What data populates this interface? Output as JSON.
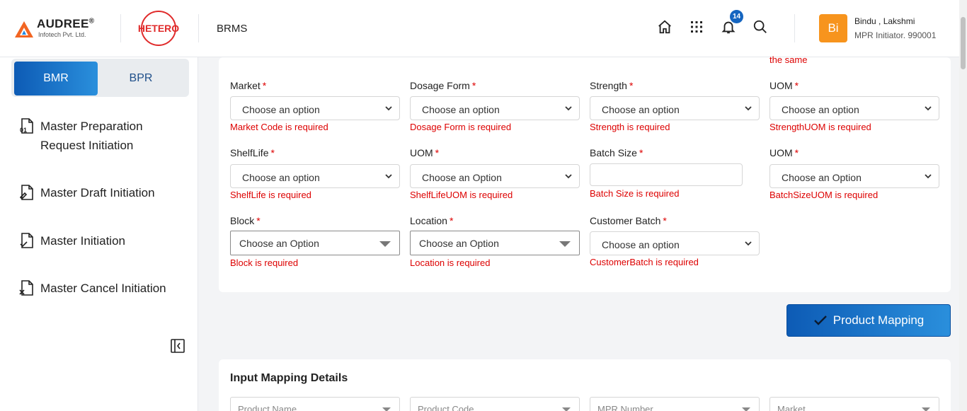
{
  "header": {
    "brand_name": "AUDREE",
    "brand_reg": "®",
    "brand_sub": "Infotech Pvt. Ltd.",
    "partner_logo": "HETERO",
    "app_name": "BRMS",
    "notification_count": "14",
    "user": {
      "initials": "Bi",
      "name": "Bindu , Lakshmi",
      "role": "MPR Initiator. 990001"
    }
  },
  "sidebar": {
    "tabs": [
      {
        "label": "BMR",
        "active": true
      },
      {
        "label": "BPR",
        "active": false
      }
    ],
    "items": [
      {
        "label": "Master Preparation Request Initiation",
        "icon": "document-number-icon"
      },
      {
        "label": "Master Draft Initiation",
        "icon": "document-edit-icon"
      },
      {
        "label": "Master Initiation",
        "icon": "document-check-icon"
      },
      {
        "label": "Master Cancel Initiation",
        "icon": "document-cancel-icon"
      }
    ]
  },
  "form": {
    "top_error": "the same",
    "fields": {
      "market": {
        "label": "Market",
        "value": "Choose an option",
        "error": "Market Code is required"
      },
      "dosage_form": {
        "label": "Dosage Form",
        "value": "Choose an option",
        "error": "Dosage Form is required"
      },
      "strength": {
        "label": "Strength",
        "value": "Choose an option",
        "error": "Strength is required"
      },
      "strength_uom": {
        "label": "UOM",
        "value": "Choose an option",
        "error": "StrengthUOM is required"
      },
      "shelf_life": {
        "label": "ShelfLife",
        "value": "Choose an option",
        "error": "ShelfLife is required"
      },
      "shelf_life_uom": {
        "label": "UOM",
        "value": "Choose an Option",
        "error": "ShelfLifeUOM is required"
      },
      "batch_size": {
        "label": "Batch Size",
        "value": "",
        "error": "Batch Size is required"
      },
      "batch_size_uom": {
        "label": "UOM",
        "value": "Choose an Option",
        "error": "BatchSizeUOM is required"
      },
      "block": {
        "label": "Block",
        "value": "Choose an Option",
        "error": "Block is required"
      },
      "location": {
        "label": "Location",
        "value": "Choose an Option",
        "error": "Location is required"
      },
      "customer_batch": {
        "label": "Customer Batch",
        "value": "Choose an option",
        "error": "CustomerBatch is required"
      }
    },
    "required_marker": "*",
    "submit_label": "Product Mapping"
  },
  "mapping": {
    "title": "Input Mapping Details",
    "filters": [
      {
        "placeholder": "Product Name"
      },
      {
        "placeholder": "Product Code"
      },
      {
        "placeholder": "MPR Number"
      },
      {
        "placeholder": "Market"
      }
    ]
  },
  "colors": {
    "accent": "#0d5bb5",
    "error": "#dd0000",
    "avatar": "#f7941d",
    "badge": "#1565c0"
  }
}
